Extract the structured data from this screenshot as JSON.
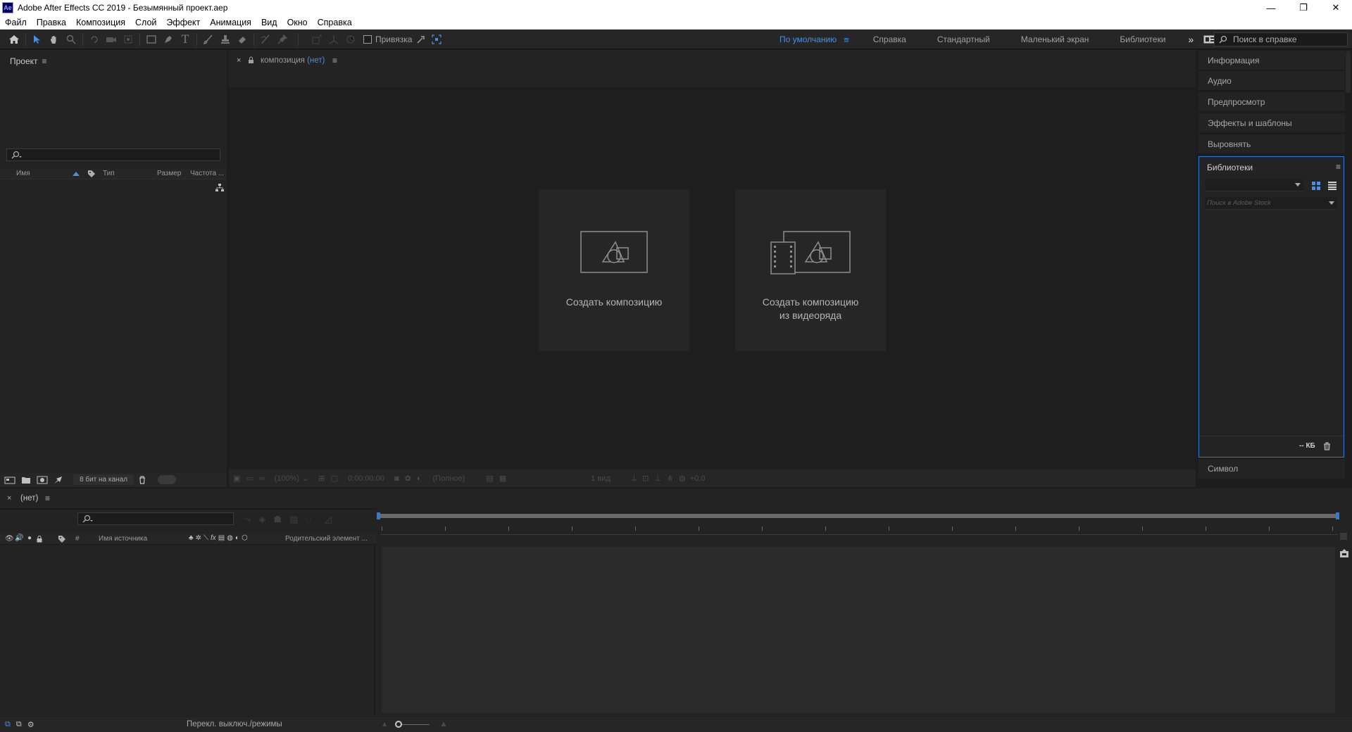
{
  "window": {
    "title": "Adobe After Effects CC 2019 - Безымянный проект.aep",
    "app_icon": "Ae",
    "controls": [
      "minimize-icon",
      "restore-icon",
      "close-icon"
    ]
  },
  "menu": [
    "Файл",
    "Правка",
    "Композиция",
    "Слой",
    "Эффект",
    "Анимация",
    "Вид",
    "Окно",
    "Справка"
  ],
  "toolbar": {
    "snap_label": "Привязка",
    "workspaces": {
      "active": "По умолчанию",
      "items": [
        "Справка",
        "Стандартный",
        "Маленький экран",
        "Библиотеки"
      ],
      "more": "»"
    },
    "help_search_placeholder": "Поиск в справке"
  },
  "project_panel": {
    "title": "Проект",
    "columns": {
      "name": "Имя",
      "type": "Тип",
      "size": "Размер",
      "rate": "Частота ..."
    },
    "footer_bpc": "8 бит на канал"
  },
  "composition_panel": {
    "tab_prefix": "композиция",
    "tab_value": "(нет)",
    "cards": {
      "new_comp": "Создать композицию",
      "from_footage_line1": "Создать композицию",
      "from_footage_line2": "из видеоряда"
    },
    "footer": {
      "zoom": "(100%)",
      "timecode": "0:00:00:00",
      "resolution": "(Полное)",
      "views": "1 вид",
      "exposure": "+0,0"
    }
  },
  "right_panels": {
    "items": [
      "Информация",
      "Аудио",
      "Предпросмотр",
      "Эффекты и шаблоны",
      "Выровнять"
    ],
    "libraries": {
      "title": "Библиотеки",
      "stock_placeholder": "Поиск в Adobe Stock",
      "storage": "-- КБ"
    },
    "below": [
      "Символ"
    ]
  },
  "timeline": {
    "tab": "(нет)",
    "columns": {
      "hash": "#",
      "source_name": "Имя источника",
      "parent": "Родительский элемент ..."
    },
    "footer_toggle": "Перекл. выключ./режимы"
  },
  "colors": {
    "accent": "#4a90e2",
    "panel": "#232323",
    "background": "#1d1d1d"
  }
}
